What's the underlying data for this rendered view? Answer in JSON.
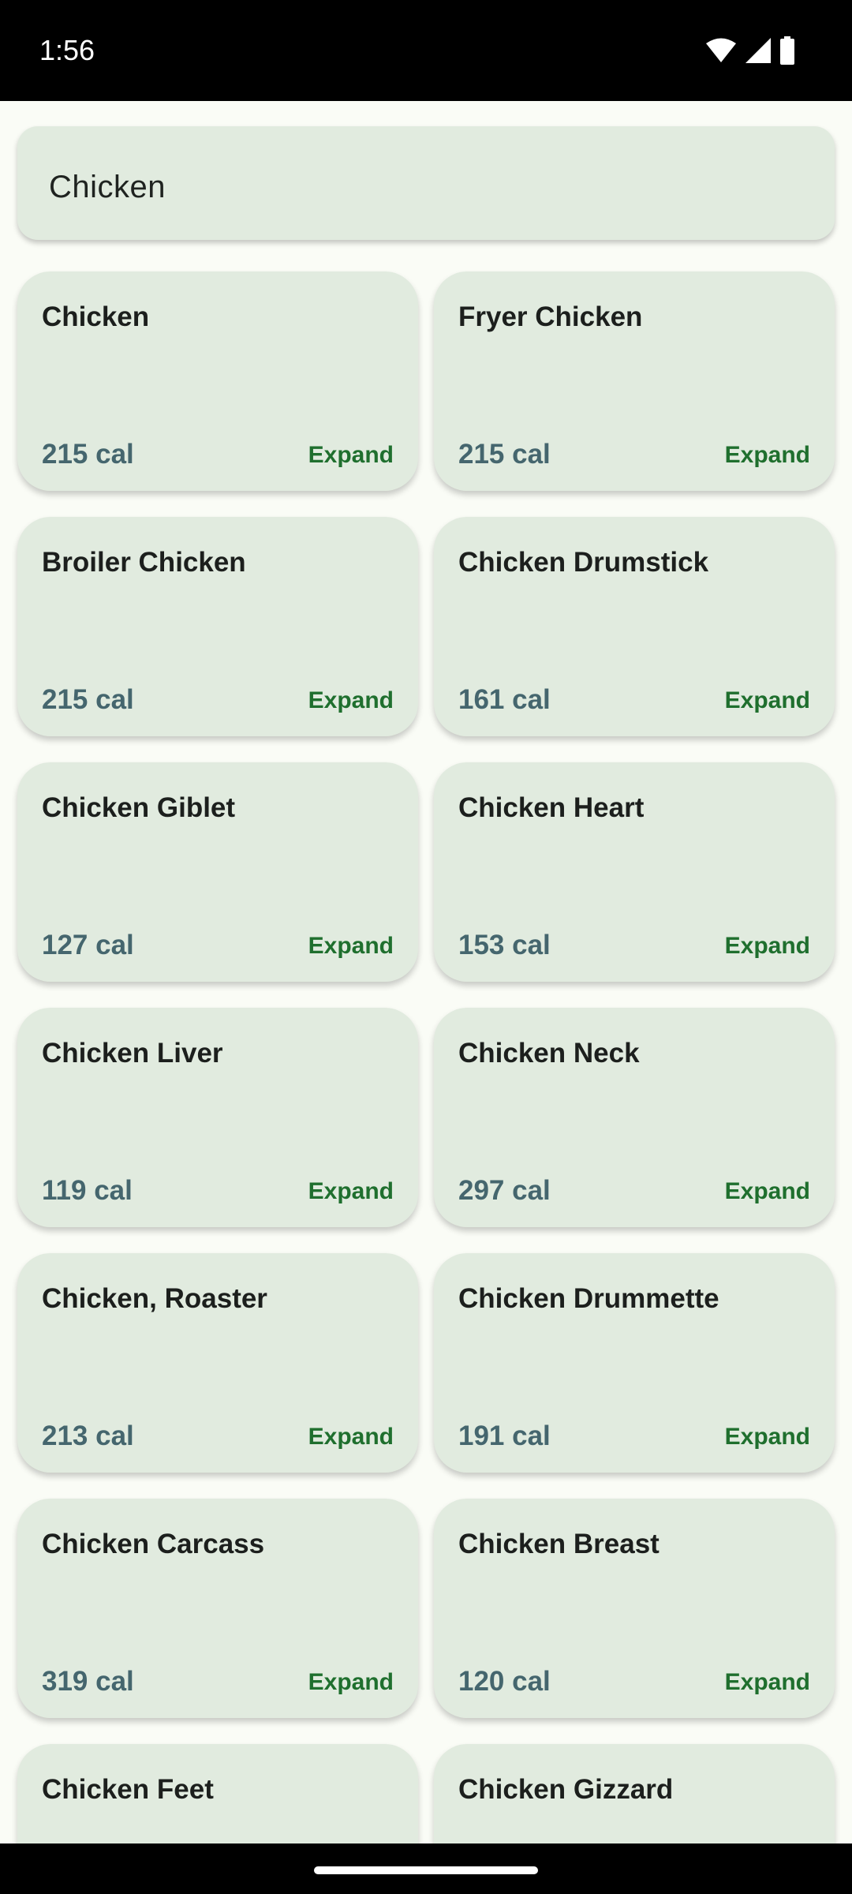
{
  "status_bar": {
    "time": "1:56",
    "icons": [
      "wifi-icon",
      "cellular-signal-icon",
      "battery-icon"
    ]
  },
  "search": {
    "value": "Chicken"
  },
  "results": [
    {
      "name": "Chicken",
      "calories": "215 cal",
      "action": "Expand"
    },
    {
      "name": "Fryer Chicken",
      "calories": "215 cal",
      "action": "Expand"
    },
    {
      "name": "Broiler Chicken",
      "calories": "215 cal",
      "action": "Expand"
    },
    {
      "name": "Chicken Drumstick",
      "calories": "161 cal",
      "action": "Expand"
    },
    {
      "name": "Chicken Giblet",
      "calories": "127 cal",
      "action": "Expand"
    },
    {
      "name": "Chicken Heart",
      "calories": "153 cal",
      "action": "Expand"
    },
    {
      "name": "Chicken Liver",
      "calories": "119 cal",
      "action": "Expand"
    },
    {
      "name": "Chicken Neck",
      "calories": "297 cal",
      "action": "Expand"
    },
    {
      "name": "Chicken, Roaster",
      "calories": "213 cal",
      "action": "Expand"
    },
    {
      "name": "Chicken Drummette",
      "calories": "191 cal",
      "action": "Expand"
    },
    {
      "name": "Chicken Carcass",
      "calories": "319 cal",
      "action": "Expand"
    },
    {
      "name": "Chicken Breast",
      "calories": "120 cal",
      "action": "Expand"
    },
    {
      "name": "Chicken Feet",
      "calories": "",
      "action": ""
    },
    {
      "name": "Chicken Gizzard",
      "calories": "",
      "action": ""
    }
  ],
  "colors": {
    "background": "#fafcf6",
    "card": "#e1ebdf",
    "calories_text": "#45666e",
    "expand_text": "#1f6f2e"
  }
}
